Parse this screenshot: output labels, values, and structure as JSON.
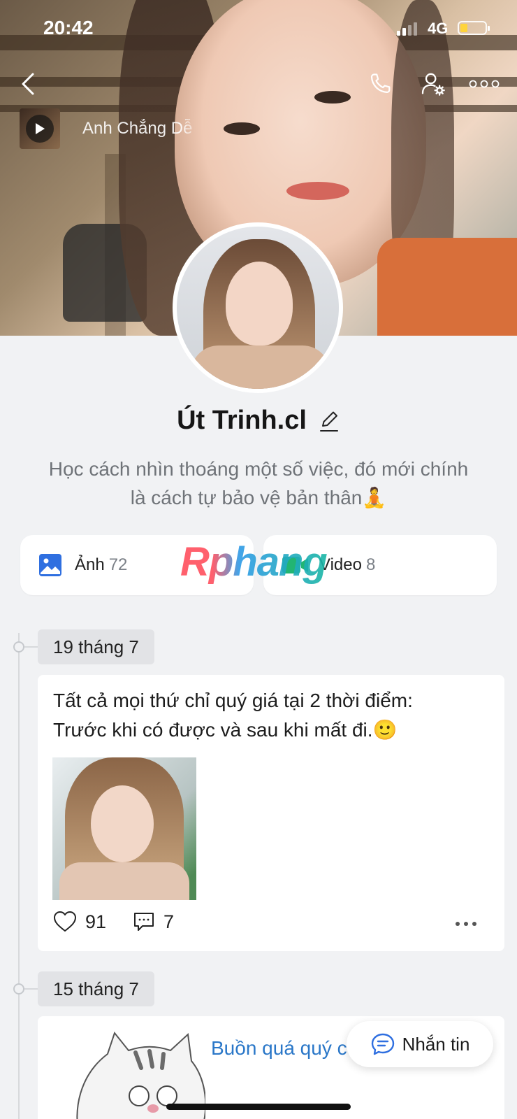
{
  "status_bar": {
    "time": "20:42",
    "network": "4G",
    "battery_level": 0.3,
    "signal_bars": 2
  },
  "header": {
    "music": {
      "title": "Anh Chẳng Dễ"
    }
  },
  "profile": {
    "name": "Út Trinh.cl",
    "bio_line1": "Học cách nhìn thoáng một số việc, đó mới chính",
    "bio_line2": "là cách tự bảo vệ bản thân🧘"
  },
  "media": {
    "photos_label": "Ảnh",
    "photos_count": "72",
    "videos_label": "Video",
    "videos_count": "8"
  },
  "watermark": "Rphang",
  "posts": [
    {
      "date": "19 tháng 7",
      "text_line1": "Tất cả mọi thứ chỉ quý giá tại 2 thời điểm:",
      "text_line2": "Trước khi có được và sau khi mất đi.🙂",
      "likes": "91",
      "comments": "7"
    },
    {
      "date": "15 tháng 7",
      "text": "Buồn quá quý c"
    }
  ],
  "fab": {
    "label": "Nhắn tin"
  },
  "colors": {
    "accent_blue": "#2f6fe0",
    "video_green": "#22b573",
    "link_blue": "#2a77c8"
  }
}
